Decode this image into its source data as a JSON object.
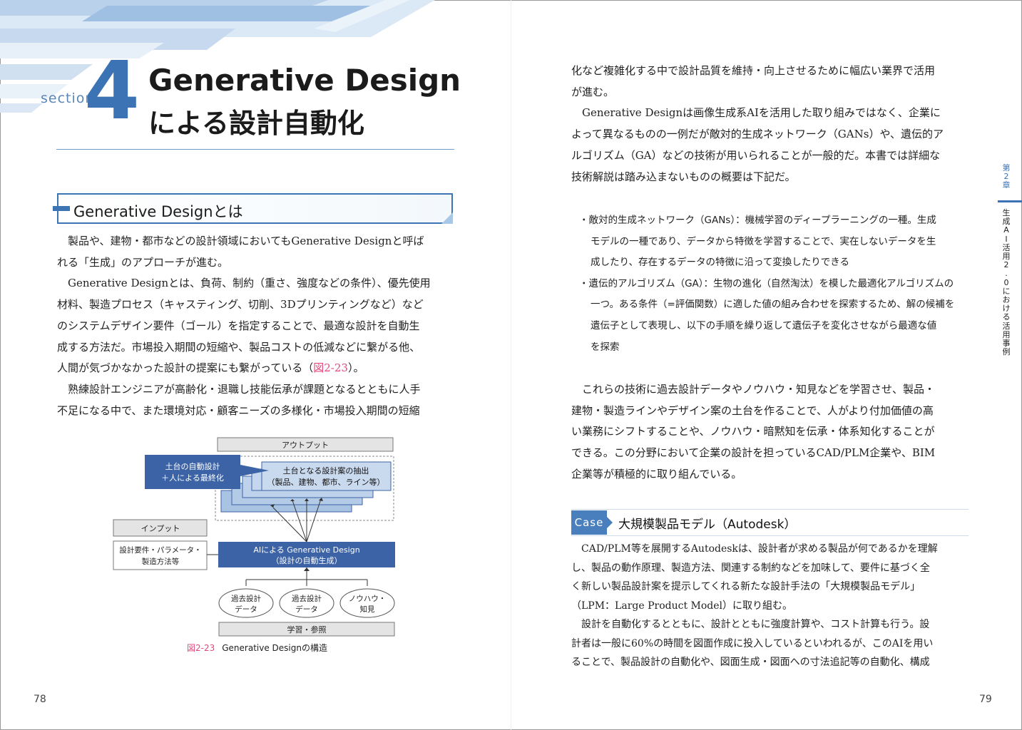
{
  "header": {
    "section_word": "section",
    "section_number": "4",
    "title_line1": "Generative Design",
    "title_line2": "による設計自動化"
  },
  "heading2": "Generative Designとは",
  "left_paragraphs": [
    "　製品や、建物・都市などの設計領域においてもGenerative Designと呼ば",
    "れる「生成」のアプローチが進む。",
    "　Generative Designとは、負荷、制約（重さ、強度などの条件）、優先使用",
    "材料、製造プロセス（キャスティング、切削、3Dプリンティングなど）など",
    "のシステムデザイン要件（ゴール）を指定することで、最適な設計を自動生",
    "成する方法だ。市場投入期間の短縮や、製品コストの低減などに繋がる他、",
    "人間が気づかなかった設計の提案にも繋がっている（",
    "　熟練設計エンジニアが高齢化・退職し技能伝承が課題となるとともに人手",
    "不足になる中で、また環境対応・顧客ニーズの多様化・市場投入期間の短縮"
  ],
  "figure_ref": "図2-23",
  "figure_ref_tail": "）。",
  "figure": {
    "output_label": "アウトプット",
    "extract_line1": "土台となる設計案の抽出",
    "extract_line2": "（製品、建物、都市、ライン等）",
    "auto_line1": "土台の自動設計",
    "auto_line2": "＋人による最終化",
    "input_label": "インプット",
    "input_items_line1": "設計要件・パラメータ・",
    "input_items_line2": "製造方法等",
    "ai_line1": "AIによる Generative Design",
    "ai_line2": "（設計の自動生成）",
    "past1_line1": "過去設計",
    "past1_line2": "データ",
    "past2_line1": "過去設計",
    "past2_line2": "データ",
    "know_line1": "ノウハウ・",
    "know_line2": "知見",
    "learn_label": "学習・参照",
    "caption_num": "図2-23",
    "caption_text": "Generative Designの構造",
    "colors": {
      "dark_blue": "#3c63a6",
      "light_blue": "#c9d9ee",
      "mid_blue": "#a9c3e3",
      "gray_label": "#e4e4e4"
    }
  },
  "right_paragraphs_top": [
    "化など複雑化する中で設計品質を維持・向上させるために幅広い業界で活用",
    "が進む。",
    "　Generative Designは画像生成系AIを活用した取り組みではなく、企業に",
    "よって異なるものの一例だが敵対的生成ネットワーク（GANs）や、遺伝的ア",
    "ルゴリズム（GA）などの技術が用いられることが一般的だ。本書では詳細な",
    "技術解説は踏み込まないものの概要は下記だ。"
  ],
  "bullets": [
    "・敵対的生成ネットワーク（GANs）：機械学習のディープラーニングの一種。生成",
    "モデルの一種であり、データから特徴を学習することで、実在しないデータを生",
    "成したり、存在するデータの特徴に沿って変換したりできる",
    "・遺伝的アルゴリズム（GA）：生物の進化（自然淘汰）を模した最適化アルゴリズムの",
    "一つ。ある条件（=評価関数）に適した値の組み合わせを探索するため、解の候補を",
    "遺伝子として表現し、以下の手順を繰り返して遺伝子を変化させながら最適な値",
    "を探索"
  ],
  "right_paragraphs_mid": [
    "　これらの技術に過去設計データやノウハウ・知見などを学習させ、製品・",
    "建物・製造ラインやデザイン案の土台を作ることで、人がより付加価値の高",
    "い業務にシフトすることや、ノウハウ・暗黙知を伝承・体系知化することが",
    "できる。この分野において企業の設計を担っているCAD/PLM企業や、BIM",
    "企業等が積極的に取り組んでいる。"
  ],
  "case": {
    "tag": "Case",
    "title": "大規模製品モデル（Autodesk）"
  },
  "right_paragraphs_case": [
    "　CAD/PLM等を展開するAutodeskは、設計者が求める製品が何であるかを理解",
    "し、製品の動作原理、製造方法、関連する制約などを加味して、要件に基づく全",
    "く新しい製品設計案を提示してくれる新たな設計手法の「大規模製品モデル」",
    "（LPM：Large Product Model）に取り組む。",
    "　設計を自動化するとともに、設計とともに強度計算や、コスト計算も行う。設",
    "計者は一般に60%の時間を図面作成に投入しているといわれるが、このAIを用い",
    "ることで、製品設計の自動化や、図面生成・図面への寸法追記等の自動化、構成"
  ],
  "side_tab": {
    "top": [
      "第",
      "2",
      "章"
    ],
    "bottom": [
      "生",
      "成",
      "A",
      "I",
      "活",
      "用",
      "2",
      ".",
      "0",
      "に",
      "お",
      "け",
      "る",
      "活",
      "用",
      "事",
      "例"
    ]
  },
  "page_left": "78",
  "page_right": "79"
}
